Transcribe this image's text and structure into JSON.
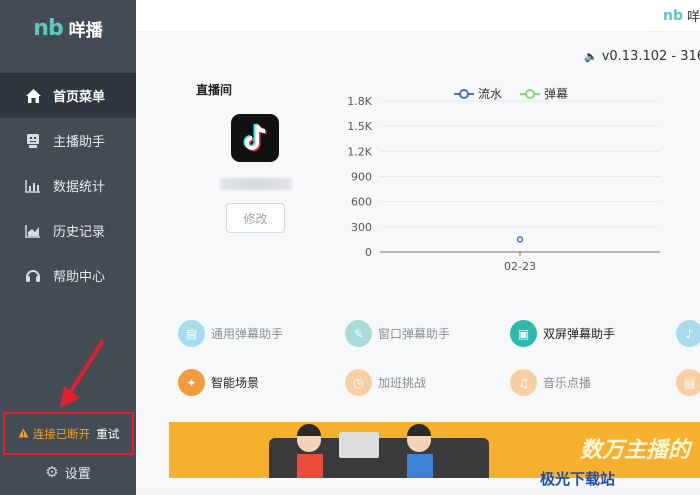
{
  "app": {
    "logo_mark": "nb",
    "name": "咩播"
  },
  "sidebar": {
    "items": [
      {
        "label": "首页菜单",
        "icon": "home-icon",
        "active": true
      },
      {
        "label": "主播助手",
        "icon": "robot-icon",
        "active": false
      },
      {
        "label": "数据统计",
        "icon": "bar-chart-icon",
        "active": false
      },
      {
        "label": "历史记录",
        "icon": "area-chart-icon",
        "active": false
      },
      {
        "label": "帮助中心",
        "icon": "headset-icon",
        "active": false
      }
    ],
    "connection": {
      "status": "连接已断开",
      "retry": "重试",
      "color": "#f0a020"
    },
    "settings_label": "设置"
  },
  "topbar": {
    "brand_mark": "nb",
    "brand_text": "咩"
  },
  "version": "v0.13.102 - 316",
  "live_room": {
    "title": "直播间",
    "edit_label": "修改"
  },
  "chart_data": {
    "type": "line",
    "categories": [
      "02-23"
    ],
    "series": [
      {
        "name": "流水",
        "color": "#4a6fb0",
        "values": [
          150
        ]
      },
      {
        "name": "弹幕",
        "color": "#8cd67a",
        "values": [
          null
        ]
      }
    ],
    "y_ticks": [
      "0",
      "300",
      "600",
      "900",
      "1.2K",
      "1.5K",
      "1.8K"
    ],
    "ylim": [
      0,
      1800
    ],
    "grid": true,
    "legend": "top-center"
  },
  "tools": [
    {
      "label": "通用弹幕助手",
      "icon": "chat-icon",
      "color": "#a8dcec",
      "active": false
    },
    {
      "label": "窗口弹幕助手",
      "icon": "edit-icon",
      "color": "#a8dcd8",
      "active": false
    },
    {
      "label": "双屏弹幕助手",
      "icon": "dual-screen-icon",
      "color": "#2fb8ad",
      "active": true
    },
    {
      "label": "",
      "icon": "microphone-icon",
      "color": "#a8dcec",
      "active": false
    },
    {
      "label": "智能场景",
      "icon": "magic-wand-icon",
      "color": "#f39a3d",
      "active": true
    },
    {
      "label": "加班挑战",
      "icon": "stopwatch-icon",
      "color": "#f8cfa3",
      "active": false
    },
    {
      "label": "音乐点播",
      "icon": "music-icon",
      "color": "#f8cfa3",
      "active": false
    },
    {
      "label": "",
      "icon": "document-icon",
      "color": "#f8cfa3",
      "active": false
    }
  ],
  "banner": {
    "text": "数万主播的"
  },
  "watermark": "极光下载站"
}
